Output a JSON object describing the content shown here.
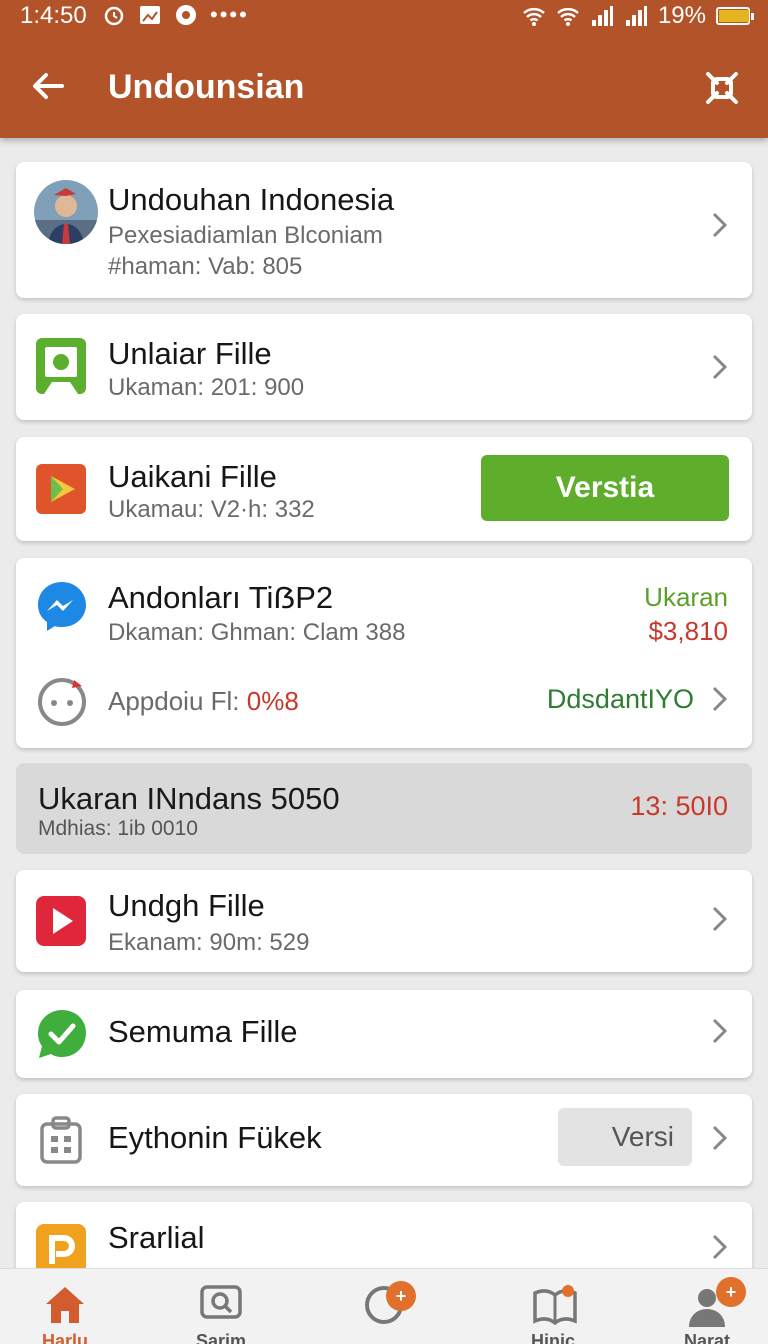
{
  "status_bar": {
    "time": "1:4:50",
    "dots": "••••",
    "battery": "19%"
  },
  "app_bar": {
    "title": "Undounsian"
  },
  "cards": [
    {
      "title": "Undouhan Indonesia",
      "subtitle": "Pexesiadiamlan Blconiam",
      "detail": "#haman: Vab: 805"
    },
    {
      "title": "Unlaiar Fille",
      "subtitle": "Ukaman: 201: 900"
    },
    {
      "title": "Uaikani Fille",
      "subtitle": "Ukamau: V2·h: 332",
      "button": "Verstia"
    },
    {
      "title": "Andonları TiẞP2",
      "subtitle": "Dkaman: Ghman: Clam 388",
      "right_label": "Ukaran",
      "right_value": "$3,810",
      "row2_label": "Appdoiu Fl:",
      "row2_value": "0%8",
      "row2_right": "DdsdantIYO"
    }
  ],
  "summary": {
    "title": "Ukaran INndans 5050",
    "subtitle": "Mdhias: 1ib 0010",
    "value": "13: 50I0"
  },
  "cards2": [
    {
      "title": "Undgh Fille",
      "subtitle": "Ekanam: 90m: 529"
    },
    {
      "title": "Semuma Fille"
    },
    {
      "title": "Eythonin Fükek",
      "button": "Versi"
    },
    {
      "title": "Srarlial"
    }
  ],
  "bottom_nav": [
    {
      "label": "Harlu",
      "icon": "home-icon"
    },
    {
      "label": "Sarim",
      "icon": "search-icon"
    },
    {
      "label": "",
      "icon": "refresh-icon",
      "badge": "+"
    },
    {
      "label": "Hinic",
      "icon": "book-icon"
    },
    {
      "label": "Narat",
      "icon": "person-icon",
      "badge": "+"
    }
  ],
  "colors": {
    "app_bar": "#b3532a",
    "green": "#5eae2c",
    "red_text": "#c8382b",
    "dark_green_text": "#2e7d32",
    "badge": "#e0702b"
  }
}
